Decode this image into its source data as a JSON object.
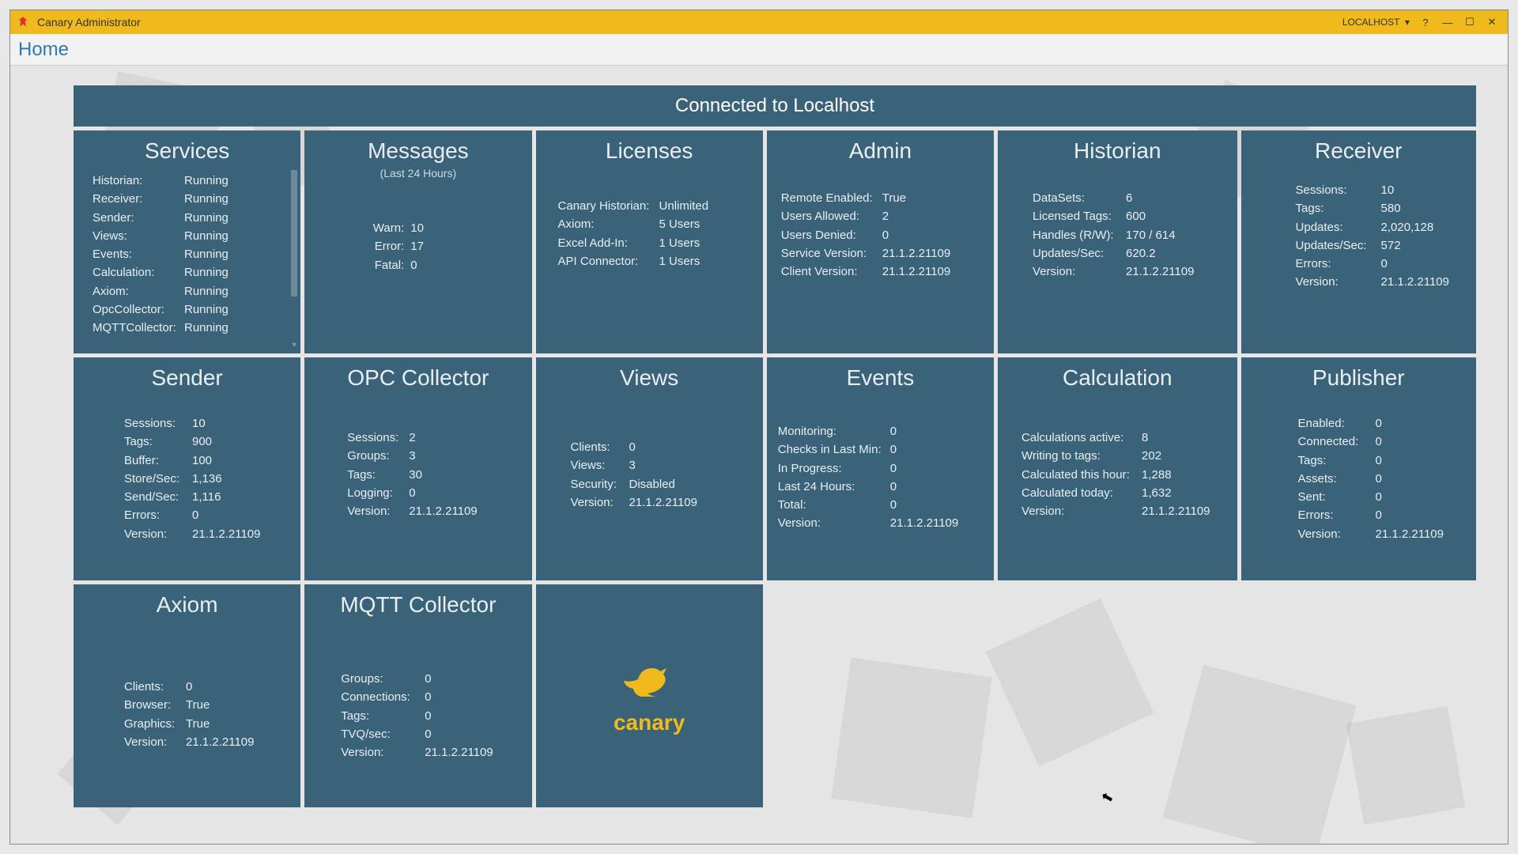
{
  "titlebar": {
    "app_title": "Canary Administrator",
    "host_label": "LOCALHOST"
  },
  "breadcrumb": "Home",
  "banner": "Connected to Localhost",
  "tiles": {
    "services": {
      "title": "Services",
      "rows": [
        {
          "k": "Historian:",
          "v": "Running"
        },
        {
          "k": "Receiver:",
          "v": "Running"
        },
        {
          "k": "Sender:",
          "v": "Running"
        },
        {
          "k": "Views:",
          "v": "Running"
        },
        {
          "k": "Events:",
          "v": "Running"
        },
        {
          "k": "Calculation:",
          "v": "Running"
        },
        {
          "k": "Axiom:",
          "v": "Running"
        },
        {
          "k": "OpcCollector:",
          "v": "Running"
        },
        {
          "k": "MQTTCollector:",
          "v": "Running"
        }
      ]
    },
    "messages": {
      "title": "Messages",
      "subtitle": "(Last 24 Hours)",
      "rows": [
        {
          "k": "Warn:",
          "v": "10"
        },
        {
          "k": "Error:",
          "v": "17"
        },
        {
          "k": "Fatal:",
          "v": "0"
        }
      ]
    },
    "licenses": {
      "title": "Licenses",
      "rows": [
        {
          "k": "Canary Historian:",
          "v": "Unlimited"
        },
        {
          "k": "Axiom:",
          "v": "5 Users"
        },
        {
          "k": "Excel Add-In:",
          "v": "1 Users"
        },
        {
          "k": "API Connector:",
          "v": "1 Users"
        }
      ]
    },
    "admin": {
      "title": "Admin",
      "rows": [
        {
          "k": "Remote Enabled:",
          "v": "True"
        },
        {
          "k": "Users Allowed:",
          "v": "2"
        },
        {
          "k": "Users Denied:",
          "v": "0"
        },
        {
          "k": "Service Version:",
          "v": "21.1.2.21109"
        },
        {
          "k": "Client Version:",
          "v": "21.1.2.21109"
        }
      ]
    },
    "historian": {
      "title": "Historian",
      "rows": [
        {
          "k": "DataSets:",
          "v": "6"
        },
        {
          "k": "Licensed Tags:",
          "v": "600"
        },
        {
          "k": "Handles (R/W):",
          "v": "170 / 614"
        },
        {
          "k": "Updates/Sec:",
          "v": "620.2"
        },
        {
          "k": "Version:",
          "v": "21.1.2.21109"
        }
      ]
    },
    "receiver": {
      "title": "Receiver",
      "rows": [
        {
          "k": "Sessions:",
          "v": "10"
        },
        {
          "k": "Tags:",
          "v": "580"
        },
        {
          "k": "Updates:",
          "v": "2,020,128"
        },
        {
          "k": "Updates/Sec:",
          "v": "572"
        },
        {
          "k": "Errors:",
          "v": "0"
        },
        {
          "k": "Version:",
          "v": "21.1.2.21109"
        }
      ]
    },
    "sender": {
      "title": "Sender",
      "rows": [
        {
          "k": "Sessions:",
          "v": "10"
        },
        {
          "k": "Tags:",
          "v": "900"
        },
        {
          "k": "Buffer:",
          "v": "100"
        },
        {
          "k": "Store/Sec:",
          "v": "1,136"
        },
        {
          "k": "Send/Sec:",
          "v": "1,116"
        },
        {
          "k": "Errors:",
          "v": "0"
        },
        {
          "k": "Version:",
          "v": "21.1.2.21109"
        }
      ]
    },
    "opc": {
      "title": "OPC Collector",
      "rows": [
        {
          "k": "Sessions:",
          "v": "2"
        },
        {
          "k": "Groups:",
          "v": "3"
        },
        {
          "k": "Tags:",
          "v": "30"
        },
        {
          "k": "Logging:",
          "v": "0"
        },
        {
          "k": "Version:",
          "v": "21.1.2.21109"
        }
      ]
    },
    "views": {
      "title": "Views",
      "rows": [
        {
          "k": "Clients:",
          "v": "0"
        },
        {
          "k": "Views:",
          "v": "3"
        },
        {
          "k": "Security:",
          "v": "Disabled"
        },
        {
          "k": "Version:",
          "v": "21.1.2.21109"
        }
      ]
    },
    "events": {
      "title": "Events",
      "rows": [
        {
          "k": "Monitoring:",
          "v": "0"
        },
        {
          "k": "Checks in Last Min:",
          "v": "0"
        },
        {
          "k": "In Progress:",
          "v": "0"
        },
        {
          "k": "Last 24 Hours:",
          "v": "0"
        },
        {
          "k": "Total:",
          "v": "0"
        },
        {
          "k": "Version:",
          "v": "21.1.2.21109"
        }
      ]
    },
    "calc": {
      "title": "Calculation",
      "rows": [
        {
          "k": "Calculations active:",
          "v": "8"
        },
        {
          "k": "Writing to tags:",
          "v": "202"
        },
        {
          "k": "Calculated this hour:",
          "v": "1,288"
        },
        {
          "k": "Calculated today:",
          "v": "1,632"
        },
        {
          "k": "Version:",
          "v": "21.1.2.21109"
        }
      ]
    },
    "publisher": {
      "title": "Publisher",
      "rows": [
        {
          "k": "Enabled:",
          "v": "0"
        },
        {
          "k": "Connected:",
          "v": "0"
        },
        {
          "k": "Tags:",
          "v": "0"
        },
        {
          "k": "Assets:",
          "v": "0"
        },
        {
          "k": "Sent:",
          "v": "0"
        },
        {
          "k": "Errors:",
          "v": "0"
        },
        {
          "k": "Version:",
          "v": "21.1.2.21109"
        }
      ]
    },
    "axiom": {
      "title": "Axiom",
      "rows": [
        {
          "k": "Clients:",
          "v": "0"
        },
        {
          "k": "Browser:",
          "v": "True"
        },
        {
          "k": "Graphics:",
          "v": "True"
        },
        {
          "k": "Version:",
          "v": "21.1.2.21109"
        }
      ]
    },
    "mqtt": {
      "title": "MQTT Collector",
      "rows": [
        {
          "k": "Groups:",
          "v": "0"
        },
        {
          "k": "Connections:",
          "v": "0"
        },
        {
          "k": "Tags:",
          "v": "0"
        },
        {
          "k": "TVQ/sec:",
          "v": "0"
        },
        {
          "k": "Version:",
          "v": "21.1.2.21109"
        }
      ]
    },
    "logo": {
      "text": "canary"
    }
  }
}
